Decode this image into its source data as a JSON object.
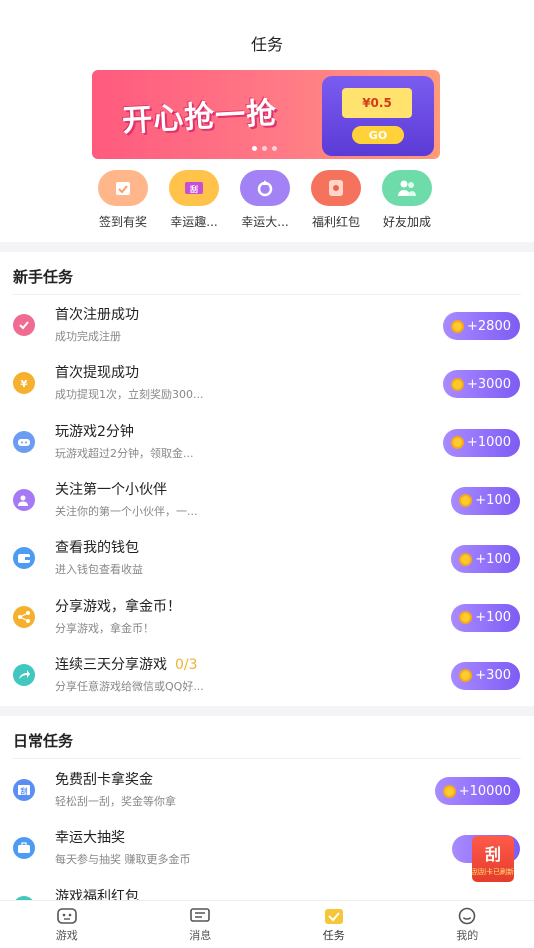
{
  "header": {
    "title": "任务"
  },
  "banner": {
    "headline": "开心抢一抢",
    "amount": "¥0.5",
    "go_label": "GO"
  },
  "shortcuts": [
    {
      "label": "签到有奖",
      "icon": "calendar-check-icon",
      "color": "#ff9d6c"
    },
    {
      "label": "幸运趣...",
      "icon": "scratch-ticket-icon",
      "color": "#f7a73a"
    },
    {
      "label": "幸运大...",
      "icon": "lucky-wheel-icon",
      "color": "#8f6cf0"
    },
    {
      "label": "福利红包",
      "icon": "red-packet-icon",
      "color": "#f2634b"
    },
    {
      "label": "好友加成",
      "icon": "friends-icon",
      "color": "#4fd19a"
    }
  ],
  "sections": {
    "newbie_title": "新手任务",
    "daily_title": "日常任务"
  },
  "newbie_tasks": [
    {
      "name": "首次注册成功",
      "progress": "",
      "desc": "成功完成注册",
      "reward": "+2800",
      "icon": "check-circle-icon",
      "color": "#f06b92"
    },
    {
      "name": "首次提现成功",
      "progress": "",
      "desc": "成功提现1次，立刻奖励300...",
      "reward": "+3000",
      "icon": "money-bag-icon",
      "color": "#f5b02e"
    },
    {
      "name": "玩游戏2分钟",
      "progress": "",
      "desc": "玩游戏超过2分钟，领取金...",
      "reward": "+1000",
      "icon": "gamepad-icon",
      "color": "#6b9cf2"
    },
    {
      "name": "关注第一个小伙伴",
      "progress": "",
      "desc": "关注你的第一个小伙伴，一...",
      "reward": "+100",
      "icon": "add-user-icon",
      "color": "#a77af5"
    },
    {
      "name": "查看我的钱包",
      "progress": "",
      "desc": "进入钱包查看收益",
      "reward": "+100",
      "icon": "wallet-icon",
      "color": "#4d9cf2"
    },
    {
      "name": "分享游戏，拿金币！",
      "progress": "",
      "desc": "分享游戏，拿金币！",
      "reward": "+100",
      "icon": "share-icon",
      "color": "#f5b02e"
    },
    {
      "name": "连续三天分享游戏",
      "progress": "0/3",
      "desc": "分享任意游戏给微信或QQ好...",
      "reward": "+300",
      "icon": "forward-icon",
      "color": "#3fc7c0"
    }
  ],
  "daily_tasks": [
    {
      "name": "免费刮卡拿奖金",
      "progress": "",
      "desc": "轻松刮一刮，奖金等你拿",
      "reward": "+10000",
      "icon": "scratch-card-icon",
      "color": "#5a8ef2"
    },
    {
      "name": "幸运大抽奖",
      "progress": "",
      "desc": "每天参与抽奖 赚取更多金币",
      "reward": "+",
      "icon": "briefcase-icon",
      "color": "#4d9cf2"
    },
    {
      "name": "游戏福利红包",
      "progress": "",
      "desc": "",
      "reward": "",
      "icon": "envelope-icon",
      "color": "#3fc7c0"
    }
  ],
  "floating_card": {
    "big": "刮",
    "small": "刮刮卡已刷新"
  },
  "tabbar": [
    {
      "label": "游戏",
      "icon": "game-face-icon",
      "active": false
    },
    {
      "label": "消息",
      "icon": "message-icon",
      "active": false
    },
    {
      "label": "任务",
      "icon": "task-check-icon",
      "active": true,
      "color": "#f7c538"
    },
    {
      "label": "我的",
      "icon": "profile-smile-icon",
      "active": false
    }
  ]
}
